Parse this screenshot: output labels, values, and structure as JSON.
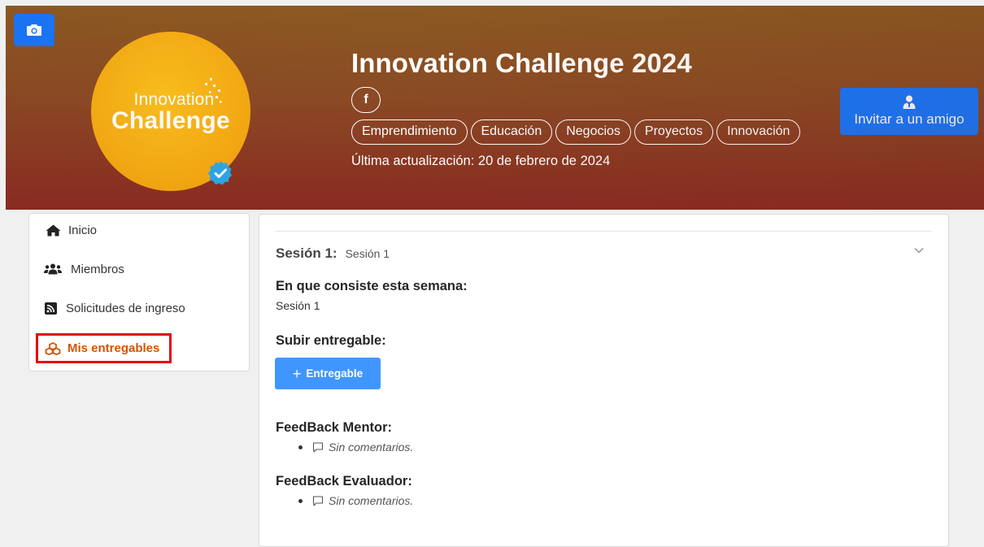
{
  "header": {
    "logo_line1": "Innovation",
    "logo_line2": "Challenge",
    "title": "Innovation Challenge 2024",
    "social_label": "f",
    "tags": [
      "Emprendimiento",
      "Educación",
      "Negocios",
      "Proyectos",
      "Innovación"
    ],
    "updated_text": "Última actualización: 20 de febrero de 2024",
    "invite_label": "Invitar a un amigo"
  },
  "sidebar": {
    "items": [
      {
        "label": "Inicio",
        "icon": "home-icon"
      },
      {
        "label": "Miembros",
        "icon": "users-icon"
      },
      {
        "label": "Solicitudes de ingreso",
        "icon": "rss-icon"
      },
      {
        "label": "Mis entregables",
        "icon": "cubes-icon",
        "active": true
      }
    ]
  },
  "main": {
    "session_label": "Sesión 1:",
    "session_name": "Sesión 1",
    "consist_heading": "En que consiste esta semana:",
    "consist_text": "Sesión 1",
    "upload_heading": "Subir entregable:",
    "upload_button": "Entregable",
    "mentor_heading": "FeedBack Mentor:",
    "mentor_comment": "Sin comentarios.",
    "evaluator_heading": "FeedBack Evaluador:",
    "evaluator_comment": "Sin comentarios."
  },
  "colors": {
    "primary": "#1677ff",
    "active_sidebar": "#d35400",
    "highlight_border": "#e8000b"
  }
}
